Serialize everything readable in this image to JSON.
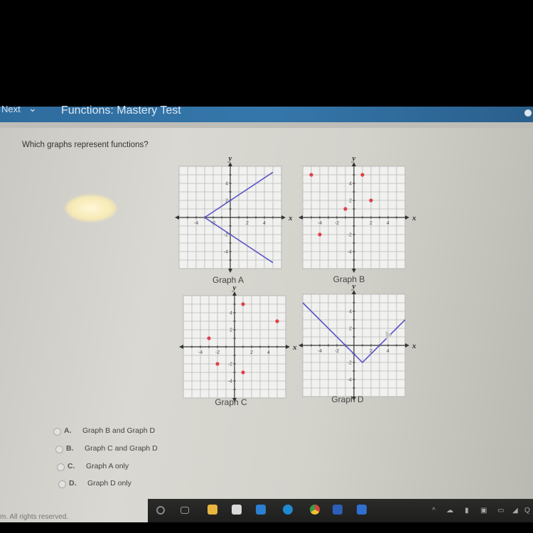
{
  "header": {
    "next_label": "Next",
    "title": "Functions: Mastery Test"
  },
  "question": "Which graphs represent functions?",
  "graphs": [
    {
      "id": "A",
      "label": "Graph A",
      "type": "line",
      "x_axis_label": "x",
      "y_axis_label": "y",
      "range": [
        -6,
        6
      ],
      "ticks": [
        "-4",
        "-2",
        "2",
        "4"
      ],
      "polyline": [
        [
          5,
          5.3
        ],
        [
          -3,
          0
        ],
        [
          5,
          -5.3
        ]
      ]
    },
    {
      "id": "B",
      "label": "Graph B",
      "type": "scatter",
      "x_axis_label": "x",
      "y_axis_label": "y",
      "range": [
        -6,
        6
      ],
      "ticks": [
        "-4",
        "-2",
        "2",
        "4"
      ],
      "points": [
        [
          -5,
          5
        ],
        [
          1,
          5
        ],
        [
          2,
          2
        ],
        [
          -1,
          1
        ],
        [
          -4,
          -2
        ]
      ]
    },
    {
      "id": "C",
      "label": "Graph C",
      "type": "scatter",
      "x_axis_label": "x",
      "y_axis_label": "y",
      "range": [
        -6,
        6
      ],
      "ticks": [
        "-4",
        "-2",
        "2",
        "4"
      ],
      "points": [
        [
          1,
          5
        ],
        [
          5,
          3
        ],
        [
          -3,
          1
        ],
        [
          -2,
          -2
        ],
        [
          1,
          -3
        ]
      ]
    },
    {
      "id": "D",
      "label": "Graph D",
      "type": "line",
      "x_axis_label": "x",
      "y_axis_label": "y",
      "range": [
        -6,
        6
      ],
      "ticks": [
        "-4",
        "-2",
        "2",
        "4"
      ],
      "polyline": [
        [
          -6,
          5
        ],
        [
          1,
          -2
        ],
        [
          6,
          3
        ]
      ]
    }
  ],
  "colors": {
    "line": "#5a55c8",
    "point": "#e0404a",
    "grid": "#b8b8b8",
    "axis": "#333333"
  },
  "options": [
    {
      "letter": "A.",
      "text": "Graph B and Graph D"
    },
    {
      "letter": "B.",
      "text": "Graph C and Graph D"
    },
    {
      "letter": "C.",
      "text": "Graph A only"
    },
    {
      "letter": "D.",
      "text": "Graph D only"
    }
  ],
  "footer": "m. All rights reserved.",
  "taskbar": {
    "icons": [
      "search-icon",
      "task-view-icon",
      "file-explorer-icon",
      "store-icon",
      "mail-icon",
      "edge-icon",
      "chrome-icon",
      "word-icon",
      "zoom-icon"
    ],
    "tray": [
      "chevron-up-icon",
      "network-icon",
      "microphone-icon",
      "camera-icon",
      "battery-icon",
      "wifi-icon",
      "volume-icon"
    ]
  }
}
